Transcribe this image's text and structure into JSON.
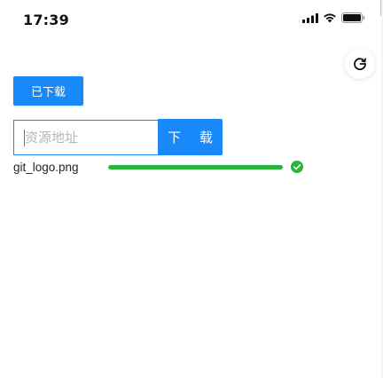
{
  "status_bar": {
    "time": "17:39",
    "icons": [
      "cellular-signal-icon",
      "wifi-icon",
      "battery-icon"
    ]
  },
  "floating_button": {
    "icon": "refresh-icon"
  },
  "downloaded_button": {
    "label": "已下载"
  },
  "url_input": {
    "placeholder": "资源地址",
    "value": ""
  },
  "download_button": {
    "label": "下 载"
  },
  "downloads": [
    {
      "file_name": "git_logo.png",
      "progress": 1.0,
      "status": "completed"
    }
  ],
  "colors": {
    "primary": "#1989fa",
    "success": "#29b53b",
    "text": "#222222"
  }
}
